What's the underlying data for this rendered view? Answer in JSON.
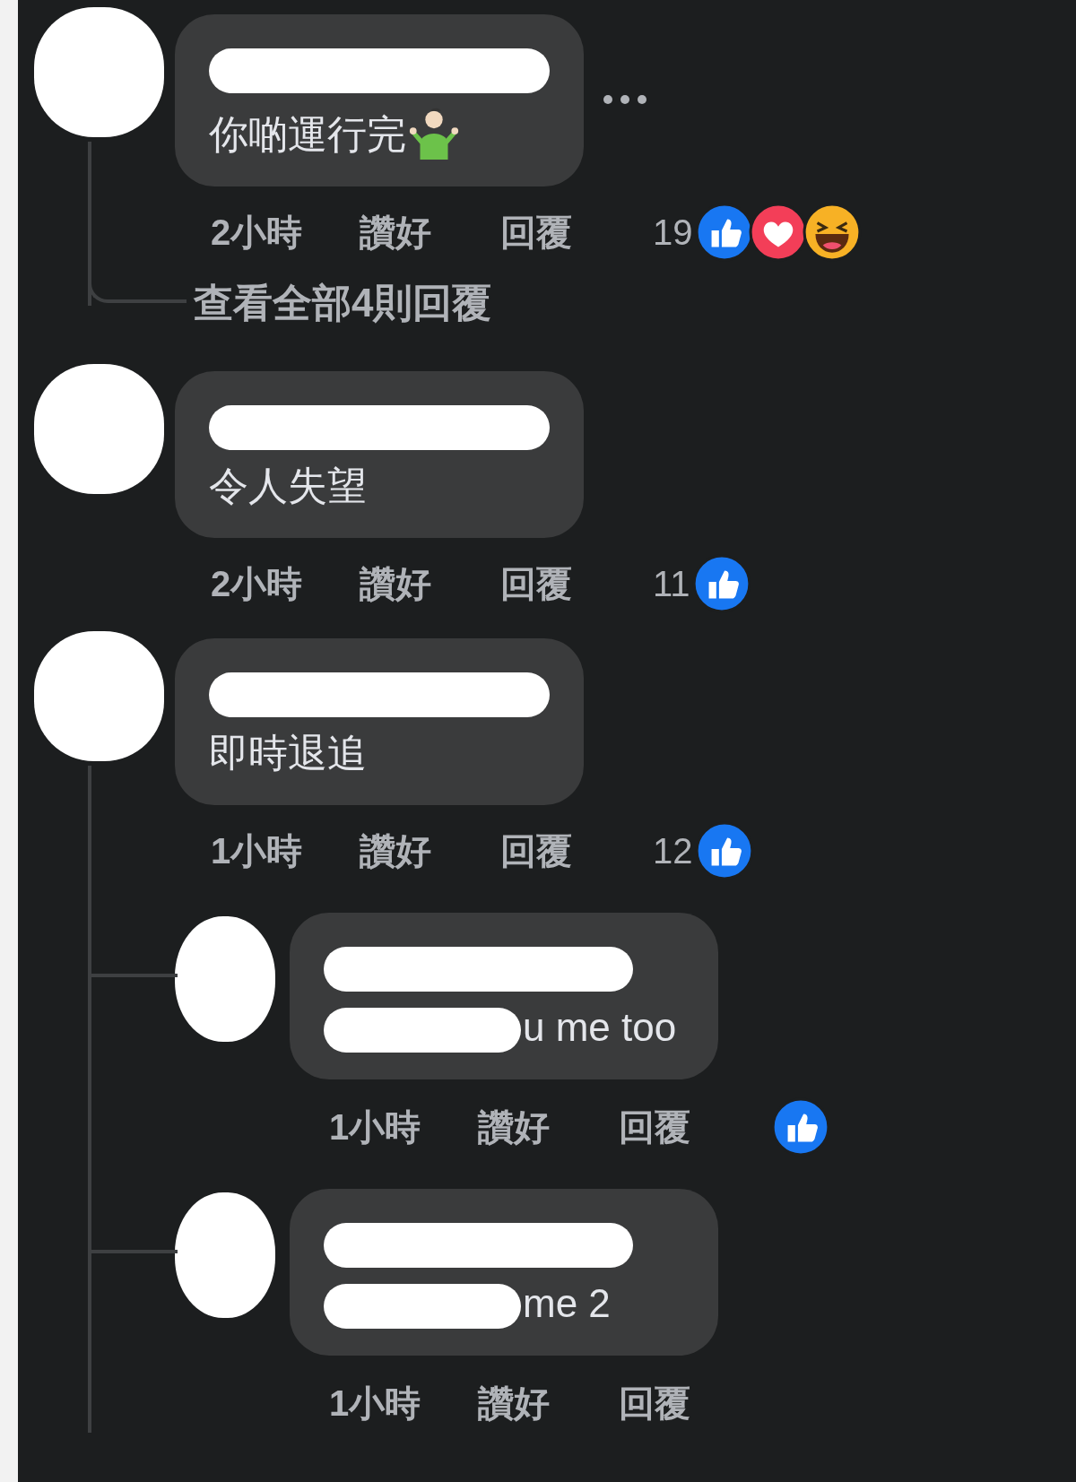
{
  "comments": [
    {
      "text": "你啲運行完",
      "shrug_emoji": true,
      "time": "2小時",
      "like": "讚好",
      "reply": "回覆",
      "reaction_count": "19",
      "reactions": [
        {
          "kind": "like"
        },
        {
          "kind": "love"
        },
        {
          "kind": "haha"
        }
      ],
      "replies_link": "查看全部4則回覆"
    },
    {
      "text": "令人失望",
      "time": "2小時",
      "like": "讚好",
      "reply": "回覆",
      "reaction_count": "11",
      "reactions": [
        {
          "kind": "like"
        }
      ]
    },
    {
      "text": "即時退追",
      "time": "1小時",
      "like": "讚好",
      "reply": "回覆",
      "reaction_count": "12",
      "reactions": [
        {
          "kind": "like"
        }
      ],
      "replies": [
        {
          "text": "u me too",
          "time": "1小時",
          "like": "讚好",
          "reply": "回覆",
          "reactions": [
            {
              "kind": "like"
            }
          ]
        },
        {
          "text": "me 2",
          "time": "1小時",
          "like": "讚好",
          "reply": "回覆"
        }
      ]
    }
  ]
}
